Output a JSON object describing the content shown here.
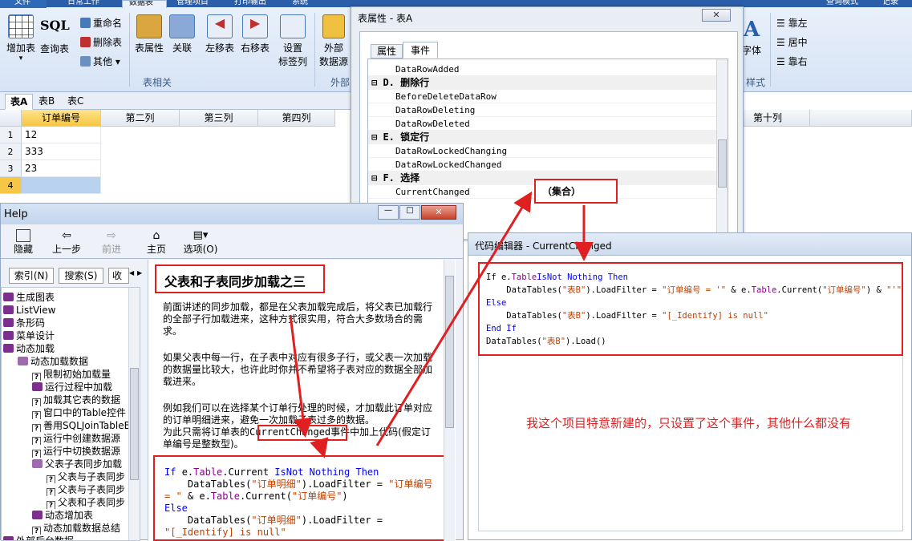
{
  "ribbon": {
    "tabs": [
      "文件",
      "日常工作",
      "数据表",
      "管理项目",
      "打印输出",
      "系统"
    ],
    "right_items": [
      "查询模式",
      "记录"
    ],
    "buttons": [
      {
        "label": "增加表",
        "sub": "▾"
      },
      {
        "label": "SQL"
      },
      {
        "label": "查询表"
      },
      {
        "label": "表属性"
      },
      {
        "label": "关联"
      },
      {
        "label": "左移表"
      },
      {
        "label": "右移表"
      },
      {
        "label": "设置",
        "label2": "标签列"
      },
      {
        "label": "外部",
        "label2": "数据源"
      }
    ],
    "small_buttons": [
      "重命名",
      "删除表",
      "其他 ▾"
    ],
    "group_labels": [
      "表相关",
      "外部",
      "样式"
    ],
    "font_label": "字体",
    "align": [
      "靠左",
      "居中",
      "靠右"
    ]
  },
  "grid": {
    "tabs": [
      "表A",
      "表B",
      "表C"
    ],
    "headers": [
      "订单编号",
      "第二列",
      "第三列",
      "第四列",
      "第十列"
    ],
    "rows": [
      {
        "n": "1",
        "v": "12"
      },
      {
        "n": "2",
        "v": "333"
      },
      {
        "n": "3",
        "v": "23"
      },
      {
        "n": "4",
        "v": ""
      }
    ]
  },
  "props": {
    "title": "表属性 - 表A",
    "close": "✕",
    "tabs": [
      "属性",
      "事件"
    ],
    "rows": [
      {
        "t": "DataRowAdded",
        "cat": false
      },
      {
        "t": "D. 删除行",
        "cat": true
      },
      {
        "t": "BeforeDeleteDataRow",
        "cat": false
      },
      {
        "t": "DataRowDeleting",
        "cat": false
      },
      {
        "t": "DataRowDeleted",
        "cat": false
      },
      {
        "t": "E. 锁定行",
        "cat": true
      },
      {
        "t": "DataRowLockedChanging",
        "cat": false
      },
      {
        "t": "DataRowLockedChanged",
        "cat": false
      },
      {
        "t": "F. 选择",
        "cat": true
      },
      {
        "t": "CurrentChanged",
        "cat": false
      }
    ],
    "collection": "（集合）"
  },
  "help": {
    "title": "Help",
    "toolbar": [
      "隐藏",
      "上一步",
      "前进",
      "主页",
      "选项(O)"
    ],
    "side_tabs": [
      "索引(N)",
      "搜索(S)",
      "收"
    ],
    "tree": [
      {
        "t": "生成图表",
        "icon": "book",
        "lvl": 0
      },
      {
        "t": "ListView",
        "icon": "book",
        "lvl": 0
      },
      {
        "t": "条形码",
        "icon": "book",
        "lvl": 0
      },
      {
        "t": "菜单设计",
        "icon": "book",
        "lvl": 0
      },
      {
        "t": "动态加载",
        "icon": "book",
        "lvl": 0
      },
      {
        "t": "动态加载数据",
        "icon": "openbook",
        "lvl": 1
      },
      {
        "t": "限制初始加载量",
        "icon": "page",
        "lvl": 2
      },
      {
        "t": "运行过程中加载",
        "icon": "book",
        "lvl": 2
      },
      {
        "t": "加载其它表的数据",
        "icon": "page",
        "lvl": 2
      },
      {
        "t": "窗口中的Table控件",
        "icon": "page",
        "lvl": 2
      },
      {
        "t": "善用SQLJoinTableB",
        "icon": "page",
        "lvl": 2
      },
      {
        "t": "运行中创建数据源",
        "icon": "page",
        "lvl": 2
      },
      {
        "t": "运行中切换数据源",
        "icon": "page",
        "lvl": 2
      },
      {
        "t": "父表子表同步加载",
        "icon": "openbook",
        "lvl": 2
      },
      {
        "t": "父表与子表同步",
        "icon": "page",
        "lvl": 3
      },
      {
        "t": "父表与子表同步",
        "icon": "page",
        "lvl": 3
      },
      {
        "t": "父表和子表同步",
        "icon": "page",
        "lvl": 3
      },
      {
        "t": "动态增加表",
        "icon": "book",
        "lvl": 2
      },
      {
        "t": "动态加载数据总结",
        "icon": "page",
        "lvl": 2
      },
      {
        "t": "外部后台数据",
        "icon": "book",
        "lvl": 0
      }
    ],
    "heading": "父表和子表同步加载之三",
    "p1": "前面讲述的同步加载，都是在父表加载完成后，将父表已加载行的全部子行加载进来，这种方式很实用，符合大多数场合的需求。",
    "p2": "如果父表中每一行，在子表中对应有很多子行，或父表一次加载的数据量比较大，也许此时你并不希望将子表对应的数据全部加载进来。",
    "p3a": "例如我们可以在选择某个订单行处理的时候，才加载此订单对应的订单明细进来，避免一次加载子表过多的数据。",
    "p3b_pre": "为此只需将订单表的",
    "p3b_ev": "CurrentChanged",
    "p3b_post": "事件中加上代码(假定订单编号是整数型)。",
    "code": {
      "if": "If",
      "e": "e.",
      "table": "Table",
      "current": ".Current",
      "isnot": "IsNot",
      "nothing": "Nothing",
      "then": "Then",
      "dt": "DataTables(",
      "mx": "\"订单明细\"",
      "lf": ").LoadFilter = ",
      "q1": "\"订单编号",
      "q2": "= \"",
      "amp": " & e.",
      "cur2": ".Current(",
      "q3": "\"订单编号\"",
      "rp": ")",
      "else": "Else",
      "ident": "\"[_Identify] is null\""
    }
  },
  "code_win": {
    "title": "代码编辑器 - CurrentChanged",
    "l1": {
      "a": "If e.",
      "b": "Table",
      ".c": ".Current ",
      "d": "IsNot Nothing Then"
    },
    "l2": {
      "a": "DataTables(",
      "b": "\"表B\"",
      "c": ").LoadFilter = ",
      "d": "\"订单编号 = '\"",
      "e": " & e.",
      "f": "Table",
      "g": ".Current(",
      "h": "\"订单编号\"",
      "i": ") & ",
      "j": "\"'\""
    },
    "l3": "Else",
    "l4": {
      "a": "DataTables(",
      "b": "\"表B\"",
      "c": ").LoadFilter = ",
      "d": "\"[_Identify] is null\""
    },
    "l5": "End If",
    "l6": {
      "a": "DataTables(",
      "b": "\"表B\"",
      "c": ").Load()"
    },
    "note": "我这个项目特意新建的，只设置了这个事件，其他什么都没有"
  },
  "colors": {
    "red": "#e02020",
    "keyword": "#0000ff",
    "string": "#c04000",
    "accent": "#2a5ea8",
    "selected": "#f6c644"
  }
}
